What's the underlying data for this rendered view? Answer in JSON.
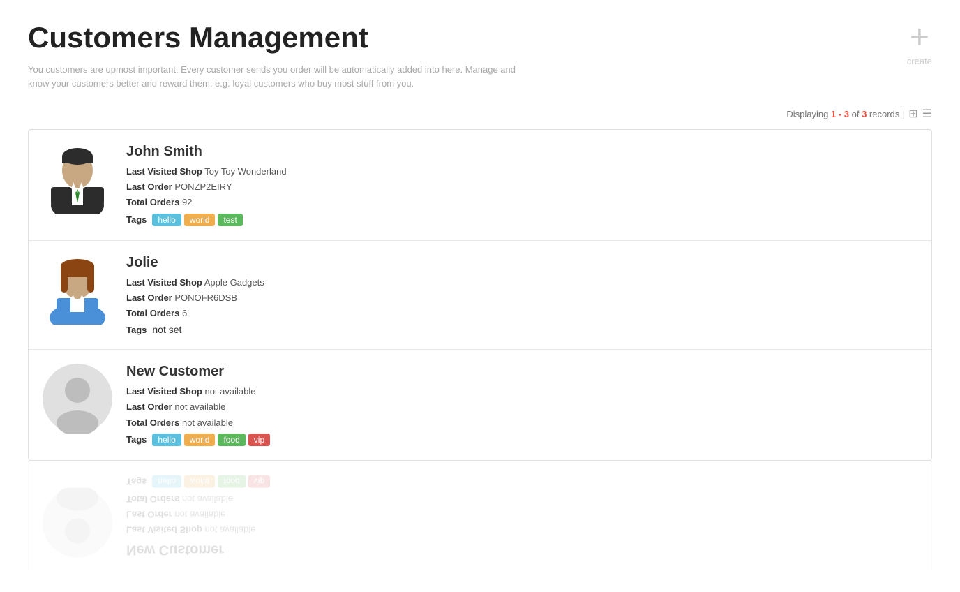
{
  "page": {
    "title": "Customers Management",
    "description": "You customers are upmost important. Every customer sends you order will be automatically added into here. Manage and know your customers better and reward them, e.g. loyal customers who buy most stuff from you.",
    "create_label": "create",
    "displaying_prefix": "Displaying ",
    "displaying_range": "1 - 3",
    "displaying_of": " of ",
    "displaying_total": "3",
    "displaying_suffix": " records |"
  },
  "customers": [
    {
      "id": 1,
      "name": "John Smith",
      "gender": "male",
      "last_visited_shop_label": "Last Visited Shop",
      "last_visited_shop_value": "Toy Toy Wonderland",
      "last_order_label": "Last Order",
      "last_order_value": "PONZP2EIRY",
      "total_orders_label": "Total Orders",
      "total_orders_value": "92",
      "tags_label": "Tags",
      "tags": [
        {
          "text": "hello",
          "color": "blue"
        },
        {
          "text": "world",
          "color": "orange"
        },
        {
          "text": "test",
          "color": "green"
        }
      ]
    },
    {
      "id": 2,
      "name": "Jolie",
      "gender": "female",
      "last_visited_shop_label": "Last Visited Shop",
      "last_visited_shop_value": "Apple Gadgets",
      "last_order_label": "Last Order",
      "last_order_value": "PONOFR6DSB",
      "total_orders_label": "Total Orders",
      "total_orders_value": "6",
      "tags_label": "Tags",
      "tags_not_set": "not set",
      "tags": []
    },
    {
      "id": 3,
      "name": "New Customer",
      "gender": "neutral",
      "last_visited_shop_label": "Last Visited Shop",
      "last_visited_shop_value": "not available",
      "last_order_label": "Last Order",
      "last_order_value": "not available",
      "total_orders_label": "Total Orders",
      "total_orders_value": "not available",
      "tags_label": "Tags",
      "tags": [
        {
          "text": "hello",
          "color": "blue"
        },
        {
          "text": "world",
          "color": "orange"
        },
        {
          "text": "food",
          "color": "green"
        },
        {
          "text": "vip",
          "color": "red"
        }
      ]
    }
  ]
}
